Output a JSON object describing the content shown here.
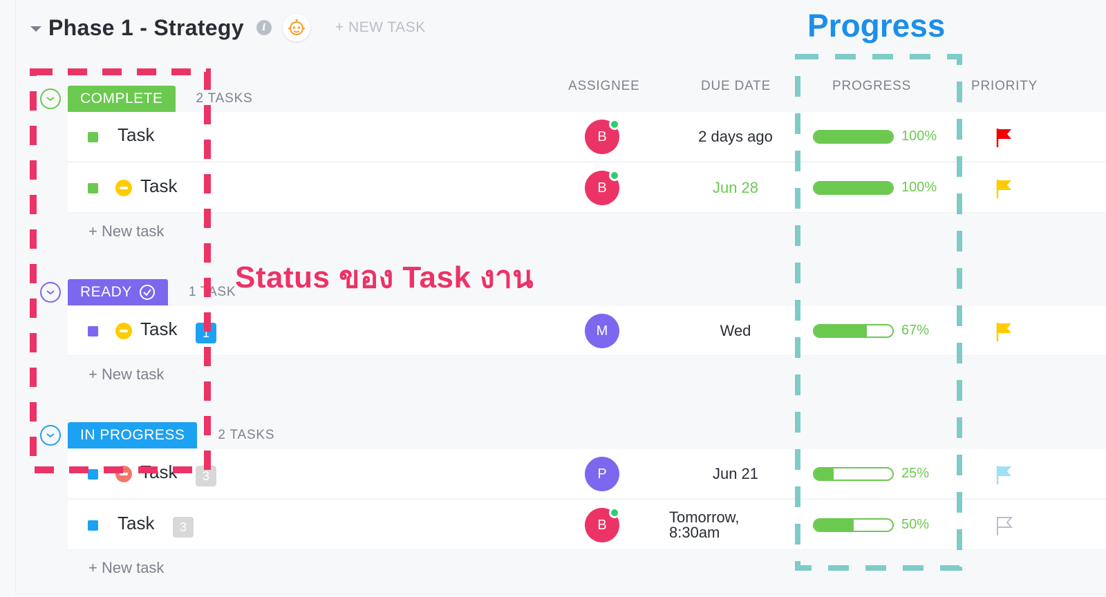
{
  "header": {
    "phase_title": "Phase 1 - Strategy",
    "info_icon": "info-icon",
    "bot_icon": "robot-icon",
    "new_task_label": "+ NEW TASK"
  },
  "columns": {
    "assignee": "ASSIGNEE",
    "due_date": "DUE DATE",
    "progress": "PROGRESS",
    "priority": "PRIORITY"
  },
  "groups": [
    {
      "status": "COMPLETE",
      "count": "2 TASKS",
      "color": "#6bc950",
      "new_task_label": "+ New task",
      "tasks": [
        {
          "name": "Task",
          "status_color": "#6bc950",
          "priority_icon": null,
          "badge": null,
          "assignee": "B",
          "assignee_color": "#ec3366",
          "online": true,
          "due": "2 days ago",
          "due_color": "#292d34",
          "progress": 100,
          "progress_label": "100%",
          "flag": "red-flag-icon",
          "flag_color": "#f50000"
        },
        {
          "name": "Task",
          "status_color": "#6bc950",
          "priority_icon": "minus-circle-icon",
          "priority_color": "#ffcc00",
          "badge": null,
          "assignee": "B",
          "assignee_color": "#ec3366",
          "online": true,
          "due": "Jun 28",
          "due_color": "#6bc950",
          "progress": 100,
          "progress_label": "100%",
          "flag": "yellow-flag-icon",
          "flag_color": "#ffcc00"
        }
      ]
    },
    {
      "status": "READY",
      "count": "1 TASK",
      "color": "#7b68ee",
      "new_task_label": "+ New task",
      "tasks": [
        {
          "name": "Task",
          "status_color": "#7b68ee",
          "priority_icon": "minus-circle-icon",
          "priority_color": "#ffcc00",
          "badge": "1",
          "badge_color": "#1da1f2",
          "assignee": "M",
          "assignee_color": "#7b68ee",
          "online": false,
          "due": "Wed",
          "due_color": "#292d34",
          "progress": 67,
          "progress_label": "67%",
          "flag": "yellow-flag-icon",
          "flag_color": "#ffcc00"
        }
      ]
    },
    {
      "status": "IN PROGRESS",
      "count": "2 TASKS",
      "color": "#1da1f2",
      "new_task_label": "+ New task",
      "tasks": [
        {
          "name": "Task",
          "status_color": "#1da1f2",
          "priority_icon": "minus-circle-icon",
          "priority_color": "#f2776a",
          "badge": "3",
          "badge_color": "#d8d8d8",
          "assignee": "P",
          "assignee_color": "#7b68ee",
          "online": false,
          "due": "Jun 21",
          "due_color": "#292d34",
          "progress": 25,
          "progress_label": "25%",
          "flag": "light-blue-flag-icon",
          "flag_color": "#9ee1f5"
        },
        {
          "name": "Task",
          "status_color": "#1da1f2",
          "priority_icon": null,
          "badge": "3",
          "badge_color": "#d8d8d8",
          "assignee": "B",
          "assignee_color": "#ec3366",
          "online": true,
          "due": "Tomorrow,\n8:30am",
          "due_color": "#292d34",
          "progress": 50,
          "progress_label": "50%",
          "flag": "empty-flag-icon",
          "flag_color": "#b9bec7"
        }
      ]
    }
  ],
  "annotations": {
    "status_note": "Status ของ Task งาน",
    "progress_note": "Progress",
    "status_box_color": "#ec3366",
    "progress_box_color": "#7ecbc7"
  }
}
